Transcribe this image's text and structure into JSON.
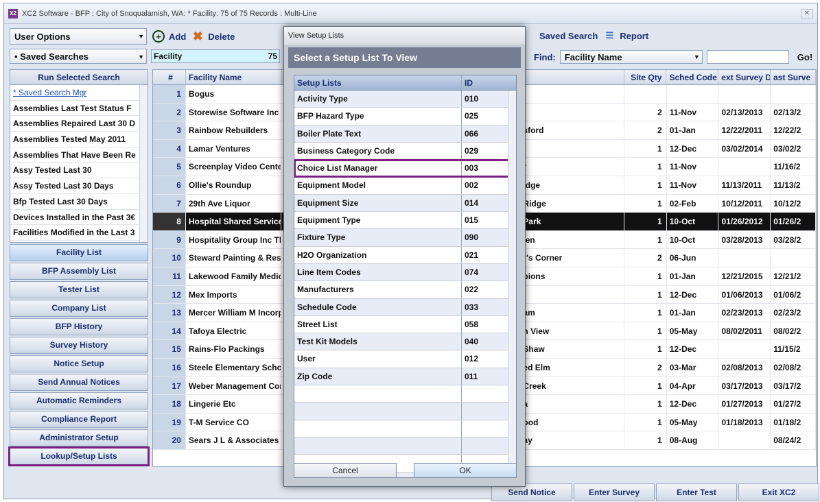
{
  "window": {
    "title": "XC2 Software - BFP : City of Snoqualamish, WA: * Facility: 75 of 75 Records : Multi-Line"
  },
  "toolbar": {
    "user_options": "User Options",
    "add": "Add",
    "delete": "Delete",
    "saved_search": "Saved Search",
    "report": "Report",
    "find_label": "Find:",
    "find_field": "Facility Name",
    "go": "Go!"
  },
  "subbar": {
    "saved_searches": "• Saved Searches",
    "mode": "Facility",
    "count": "75"
  },
  "saved_searches": {
    "header": "Run Selected Search",
    "items": [
      "* Saved Search Mgr",
      "Assemblies Last Test Status F",
      "Assemblies Repaired Last 30 D",
      "Assemblies Tested May 2011",
      "Assemblies That Have Been Re",
      "Assy Tested Last 30",
      "Assy Tested Last 30 Days",
      "Bfp Tested Last 30 Days",
      "Devices Installed in the Past 3€",
      "Facilities Modified in the Last 3"
    ]
  },
  "nav": [
    "Facility List",
    "BFP Assembly List",
    "Tester List",
    "Company List",
    "BFP History",
    "Survey History",
    "Notice Setup",
    "Send Annual Notices",
    "Automatic Reminders",
    "Compliance Report",
    "Administrator Setup",
    "Lookup/Setup Lists"
  ],
  "grid": {
    "columns": {
      "num": "#",
      "name": "Facility Name",
      "site_qty": "Site Qty",
      "sched": "Sched Code",
      "next": "ext Survey Da",
      "last": "ast Surve"
    },
    "rows": [
      {
        "n": "1",
        "name": "Bogus",
        "tail": "",
        "qty": "",
        "sched": "",
        "d1": "",
        "d2": ""
      },
      {
        "n": "2",
        "name": "Storewise Software Inc",
        "tail": "",
        "qty": "2",
        "sched": "11-Nov",
        "d1": "02/13/2013",
        "d2": "02/13/2"
      },
      {
        "n": "3",
        "name": "Rainbow Rebuilders",
        "tail": "sford",
        "qty": "2",
        "sched": "01-Jan",
        "d1": "12/22/2011",
        "d2": "12/22/2"
      },
      {
        "n": "4",
        "name": "Lamar Ventures",
        "tail": "",
        "qty": "1",
        "sched": "12-Dec",
        "d1": "03/02/2014",
        "d2": "03/02/2"
      },
      {
        "n": "5",
        "name": "Screenplay Video Centers",
        "tail": "r",
        "qty": "1",
        "sched": "11-Nov",
        "d1": "",
        "d2": "11/16/2"
      },
      {
        "n": "6",
        "name": "Ollie's Roundup",
        "tail": "idge",
        "qty": "1",
        "sched": "11-Nov",
        "d1": "11/13/2011",
        "d2": "11/13/2"
      },
      {
        "n": "7",
        "name": "29th Ave Liquor",
        "tail": "Ridge",
        "qty": "1",
        "sched": "02-Feb",
        "d1": "10/12/2011",
        "d2": "10/12/2"
      },
      {
        "n": "8",
        "name": "Hospital Shared Services",
        "tail": "Park",
        "qty": "1",
        "sched": "10-Oct",
        "d1": "01/26/2012",
        "d2": "01/26/2"
      },
      {
        "n": "9",
        "name": "Hospitality Group Inc The",
        "tail": "len",
        "qty": "1",
        "sched": "10-Oct",
        "d1": "03/28/2013",
        "d2": "03/28/2"
      },
      {
        "n": "10",
        "name": "Steward Painting & Resto",
        "tail": "r's Corner",
        "qty": "2",
        "sched": "06-Jun",
        "d1": "",
        "d2": ""
      },
      {
        "n": "11",
        "name": "Lakewood Family Medical",
        "tail": "pions",
        "qty": "1",
        "sched": "01-Jan",
        "d1": "12/21/2015",
        "d2": "12/21/2"
      },
      {
        "n": "12",
        "name": "Mex Imports",
        "tail": "",
        "qty": "1",
        "sched": "12-Dec",
        "d1": "01/06/2013",
        "d2": "01/06/2"
      },
      {
        "n": "13",
        "name": "Mercer William M Incorpo",
        "tail": "am",
        "qty": "1",
        "sched": "01-Jan",
        "d1": "02/23/2013",
        "d2": "02/23/2"
      },
      {
        "n": "14",
        "name": "Tafoya Electric",
        "tail": "h View",
        "qty": "1",
        "sched": "05-May",
        "d1": "08/02/2011",
        "d2": "08/02/2"
      },
      {
        "n": "15",
        "name": "Rains-Flo Packings",
        "tail": "Shaw",
        "qty": "1",
        "sched": "12-Dec",
        "d1": "",
        "d2": "11/15/2"
      },
      {
        "n": "16",
        "name": "Steele Elementary School",
        "tail": "ed Elm",
        "qty": "2",
        "sched": "03-Mar",
        "d1": "02/08/2013",
        "d2": "02/08/2"
      },
      {
        "n": "17",
        "name": "Weber Management Comp",
        "tail": "Creek",
        "qty": "1",
        "sched": "04-Apr",
        "d1": "03/17/2013",
        "d2": "03/17/2"
      },
      {
        "n": "18",
        "name": "Lingerie Etc",
        "tail": "a",
        "qty": "1",
        "sched": "12-Dec",
        "d1": "01/27/2013",
        "d2": "01/27/2"
      },
      {
        "n": "19",
        "name": "T-M Service CO",
        "tail": "ood",
        "qty": "1",
        "sched": "05-May",
        "d1": "01/18/2013",
        "d2": "01/18/2"
      },
      {
        "n": "20",
        "name": "Sears J L & Associates R",
        "tail": "ay",
        "qty": "1",
        "sched": "08-Aug",
        "d1": "",
        "d2": "08/24/2"
      }
    ]
  },
  "bottom": {
    "send_notice": "Send Notice",
    "enter_survey": "Enter Survey",
    "enter_test": "Enter Test",
    "exit": "Exit XC2"
  },
  "modal": {
    "title": "View Setup Lists",
    "heading": "Select a Setup List To View",
    "col_name": "Setup Lists",
    "col_id": "ID",
    "items": [
      {
        "name": "Activity Type",
        "id": "010"
      },
      {
        "name": "BFP Hazard Type",
        "id": "025"
      },
      {
        "name": "Boiler Plate Text",
        "id": "066"
      },
      {
        "name": "Business Category Code",
        "id": "029"
      },
      {
        "name": "Choice List Manager",
        "id": "003"
      },
      {
        "name": "Equipment Model",
        "id": "002"
      },
      {
        "name": "Equipment Size",
        "id": "014"
      },
      {
        "name": "Equipment Type",
        "id": "015"
      },
      {
        "name": "Fixture Type",
        "id": "090"
      },
      {
        "name": "H2O Organization",
        "id": "021"
      },
      {
        "name": "Line Item Codes",
        "id": "074"
      },
      {
        "name": "Manufacturers",
        "id": "022"
      },
      {
        "name": "Schedule Code",
        "id": "033"
      },
      {
        "name": "Street List",
        "id": "058"
      },
      {
        "name": "Test Kit Models",
        "id": "040"
      },
      {
        "name": "User",
        "id": "012"
      },
      {
        "name": "Zip Code",
        "id": "011"
      }
    ],
    "cancel": "Cancel",
    "ok": "OK"
  },
  "colors": {
    "highlight": "#7b1f84",
    "selected_row": "#111111",
    "header": "#757d93"
  }
}
